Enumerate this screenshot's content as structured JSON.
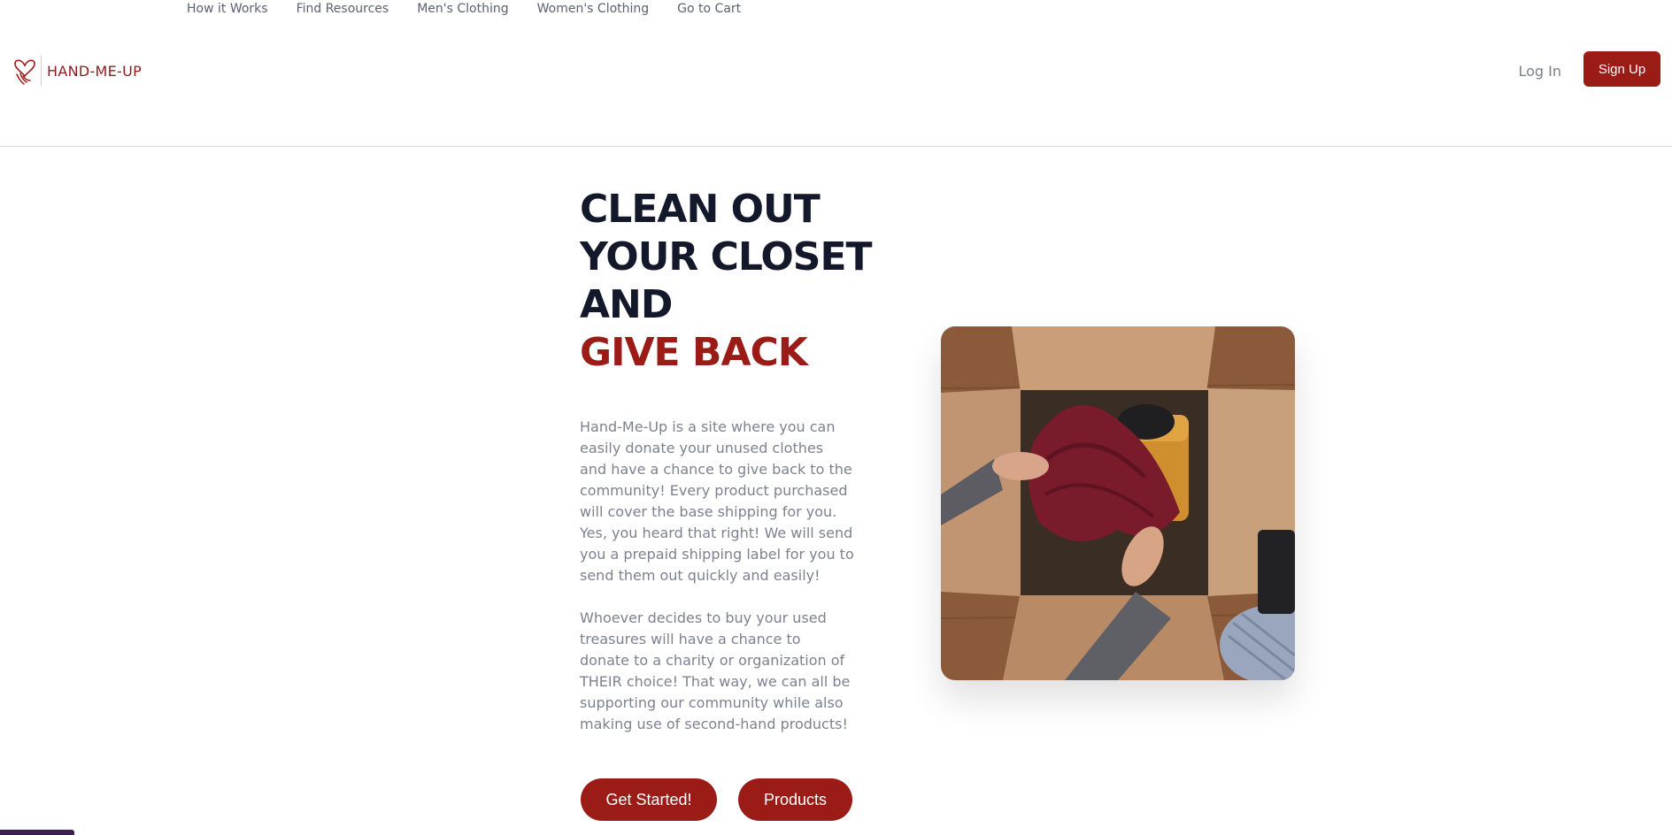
{
  "top_nav": {
    "links": [
      "How it Works",
      "Find Resources",
      "Men's Clothing",
      "Women's Clothing",
      "Go to Cart"
    ]
  },
  "header": {
    "logo_text": "HAND-ME-UP",
    "login_label": "Log In",
    "signup_label": "Sign Up"
  },
  "hero": {
    "title_lines": [
      "CLEAN OUT",
      "YOUR CLOSET",
      "AND"
    ],
    "title_accent": "GIVE BACK",
    "paragraph_1": "Hand-Me-Up is a site where you can easily donate your unused clothes and have a chance to give back to the community! Every product purchased will cover the base shipping for you. Yes, you heard that right! We will send you a prepaid shipping label for you to send them out quickly and easily!",
    "paragraph_2": "Whoever decides to buy your used treasures will have a chance to donate to a charity or organization of THEIR choice! That way, we can all be supporting our community while also making use of second-hand products!",
    "get_started_label": "Get Started!",
    "products_label": "Products"
  },
  "colors": {
    "brand": "#9b1b17",
    "heading": "#14182b",
    "body_text": "#7d8290"
  },
  "icons": {
    "logo": "heart-hands-icon"
  }
}
